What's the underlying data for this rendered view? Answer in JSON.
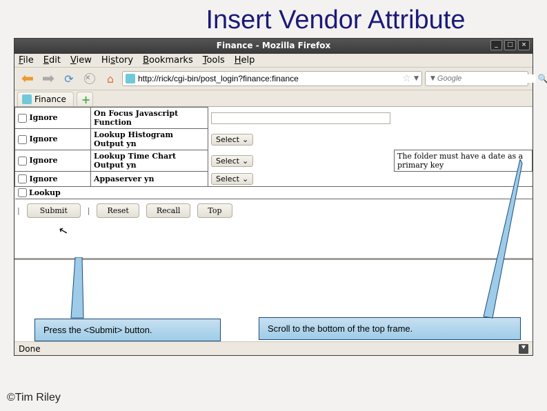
{
  "slide": {
    "title": "Insert Vendor Attribute",
    "copyright": "©Tim Riley"
  },
  "window": {
    "title": "Finance - Mozilla Firefox"
  },
  "menu": {
    "file": "File",
    "edit": "Edit",
    "view": "View",
    "history": "History",
    "bookmarks": "Bookmarks",
    "tools": "Tools",
    "help": "Help"
  },
  "nav": {
    "url": "http://rick/cgi-bin/post_login?finance:finance",
    "search_placeholder": "Google"
  },
  "tab": {
    "label": "Finance"
  },
  "form": {
    "ignore": "Ignore",
    "lookup": "Lookup",
    "rows": [
      {
        "label": "On Focus Javascript Function",
        "control": "text"
      },
      {
        "label": "Lookup Histogram Output yn",
        "control": "select"
      },
      {
        "label": "Lookup Time Chart Output yn",
        "control": "select",
        "hint": "The folder must have a date as a primary key"
      },
      {
        "label": "Appaserver yn",
        "control": "select"
      }
    ],
    "select_text": "Select"
  },
  "buttons": {
    "submit": "Submit",
    "reset": "Reset",
    "recall": "Recall",
    "top": "Top"
  },
  "status": {
    "text": "Done"
  },
  "callouts": {
    "left": "Press the <Submit> button.",
    "right": "Scroll to the bottom of the top frame."
  }
}
